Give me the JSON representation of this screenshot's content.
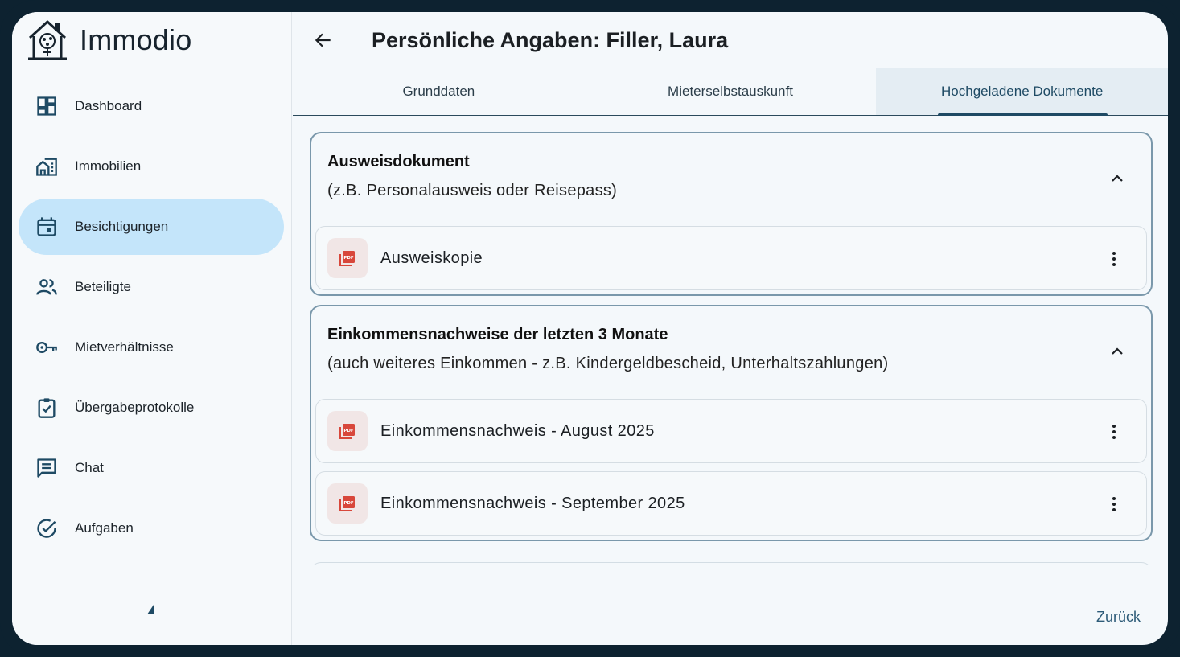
{
  "app": {
    "name": "Immodio"
  },
  "sidebar": {
    "items": [
      {
        "label": "Dashboard",
        "icon": "dashboard-icon"
      },
      {
        "label": "Immobilien",
        "icon": "buildings-icon"
      },
      {
        "label": "Besichtigungen",
        "icon": "calendar-icon",
        "active": true
      },
      {
        "label": "Beteiligte",
        "icon": "people-icon"
      },
      {
        "label": "Mietverhältnisse",
        "icon": "key-icon"
      },
      {
        "label": "Übergabeprotokolle",
        "icon": "clipboard-check-icon"
      },
      {
        "label": "Chat",
        "icon": "chat-icon"
      },
      {
        "label": "Aufgaben",
        "icon": "check-circle-icon"
      }
    ]
  },
  "header": {
    "title": "Persönliche Angaben: Filler, Laura"
  },
  "tabs": [
    {
      "label": "Grunddaten"
    },
    {
      "label": "Mieterselbstauskunft"
    },
    {
      "label": "Hochgeladene Dokumente",
      "active": true
    }
  ],
  "sections": [
    {
      "title": "Ausweisdokument",
      "subtitle": "(z.B. Personalausweis oder Reisepass)",
      "documents": [
        {
          "name": "Ausweiskopie"
        }
      ]
    },
    {
      "title": "Einkommensnachweise der letzten 3 Monate",
      "subtitle": "(auch weiteres Einkommen - z.B. Kindergeldbescheid, Unterhaltszahlungen)",
      "documents": [
        {
          "name": "Einkommensnachweis - August 2025"
        },
        {
          "name": "Einkommensnachweis - September 2025"
        }
      ]
    }
  ],
  "footer": {
    "back_label": "Zurück"
  },
  "colors": {
    "accent": "#1e4a64",
    "active_nav": "#c4e5fa",
    "pdf_red": "#d8473b"
  }
}
